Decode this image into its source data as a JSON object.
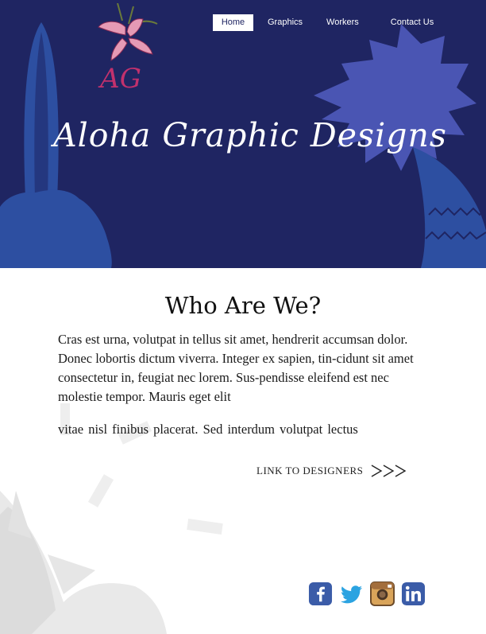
{
  "nav": {
    "items": [
      {
        "label": "Home",
        "active": true
      },
      {
        "label": "Graphics",
        "active": false
      },
      {
        "label": "Workers",
        "active": false
      },
      {
        "label": "Contact Us",
        "active": false
      }
    ]
  },
  "header": {
    "logo_monogram": "AG",
    "site_title": "Aloha Graphic Designs"
  },
  "main": {
    "heading": "Who Are We?",
    "intro": "Cras est urna, volutpat in tellus sit amet, hendrerit accumsan dolor. Donec lobortis dictum viverra. Integer ex sapien, tin-cidunt sit amet consectetur in, feugiat nec lorem. Sus-pendisse eleifend est nec molestie tempor. Mauris eget elit",
    "intro_2": "vitae nisl  finibus placerat. Sed interdum  volutpat lectus",
    "designers_link_label": "LINK TO DESIGNERS",
    "designers_link_arrows": ">>>"
  },
  "social": {
    "icons": [
      "facebook-icon",
      "twitter-icon",
      "instagram-icon",
      "linkedin-icon"
    ]
  },
  "colors": {
    "header_bg": "#1f2562",
    "accent_blue": "#2d4fa1",
    "leaf_blue": "#4a55b3",
    "nav_active_bg": "#ffffff"
  }
}
